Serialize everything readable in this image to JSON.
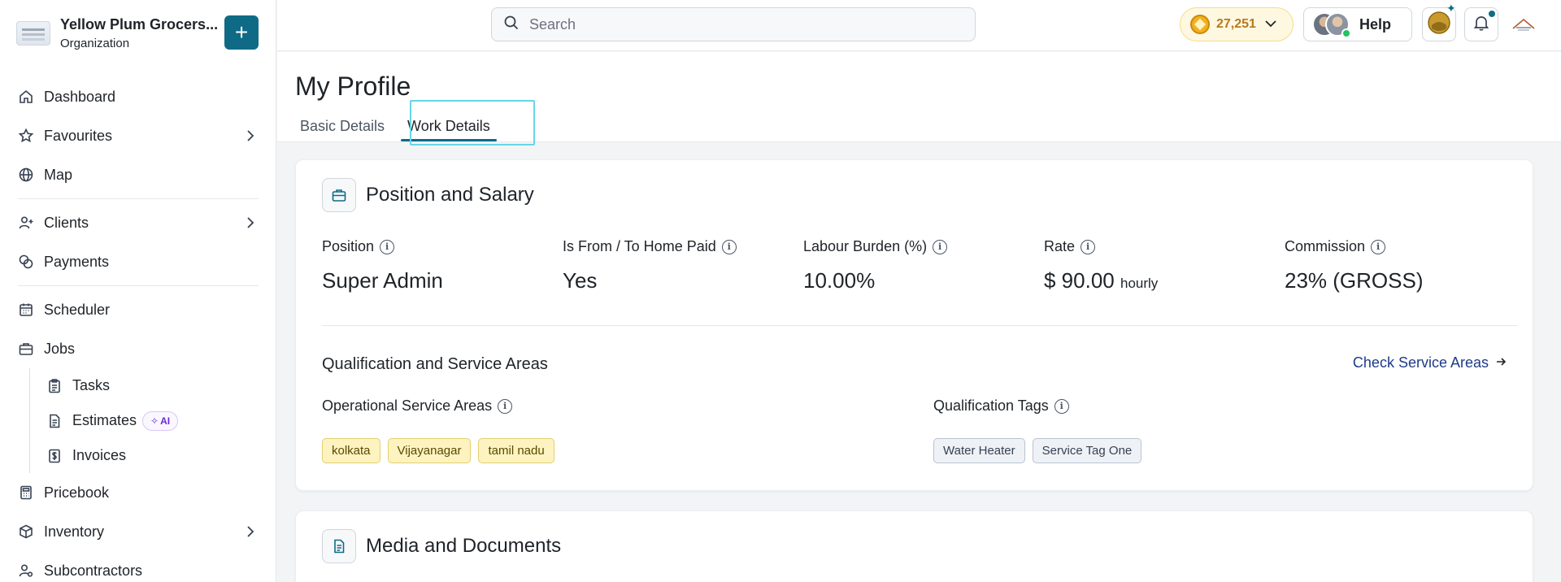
{
  "org": {
    "name": "Yellow Plum Grocers...",
    "type": "Organization",
    "add_label": "+"
  },
  "nav": {
    "dashboard": "Dashboard",
    "favourites": "Favourites",
    "map": "Map",
    "clients": "Clients",
    "payments": "Payments",
    "scheduler": "Scheduler",
    "jobs": "Jobs",
    "tasks": "Tasks",
    "estimates": "Estimates",
    "ai_badge": "AI",
    "invoices": "Invoices",
    "pricebook": "Pricebook",
    "inventory": "Inventory",
    "subcontractors": "Subcontractors"
  },
  "topbar": {
    "search_placeholder": "Search",
    "coins": "27,251",
    "help": "Help"
  },
  "page": {
    "title": "My Profile",
    "tabs": [
      {
        "label": "Basic Details",
        "active": false
      },
      {
        "label": "Work Details",
        "active": true
      }
    ]
  },
  "position_salary": {
    "title": "Position and Salary",
    "stats": [
      {
        "label": "Position",
        "value": "Super Admin",
        "unit": ""
      },
      {
        "label": "Is From / To Home Paid",
        "value": "Yes",
        "unit": ""
      },
      {
        "label": "Labour Burden (%)",
        "value": "10.00%",
        "unit": ""
      },
      {
        "label": "Rate",
        "value": "$ 90.00",
        "unit": "hourly"
      },
      {
        "label": "Commission",
        "value": "23% (GROSS)",
        "unit": ""
      }
    ],
    "qualification_title": "Qualification and Service Areas",
    "check_link": "Check Service Areas",
    "service_areas_label": "Operational Service Areas",
    "service_areas": [
      "kolkata",
      "Vijayanagar",
      "tamil nadu"
    ],
    "qualification_label": "Qualification Tags",
    "qualification_tags": [
      "Water Heater",
      "Service Tag One"
    ]
  },
  "media": {
    "title": "Media and Documents"
  },
  "colors": {
    "brand": "#0f6b85",
    "tag_yellow": "#fcf3c0",
    "tag_gray": "#eef2f7",
    "link": "#1e3a8a",
    "focus_ring": "#67d6e6"
  },
  "icons": {
    "home": "home-icon",
    "star": "star-icon",
    "globe": "globe-icon",
    "user_plus": "user-plus-icon",
    "coins": "coins-icon",
    "calendar": "calendar-icon",
    "briefcase": "briefcase-icon",
    "clipboard": "clipboard-icon",
    "document": "document-icon",
    "dollar": "dollar-icon",
    "calculator": "calculator-icon",
    "box": "box-icon",
    "user_cog": "user-cog-icon"
  }
}
